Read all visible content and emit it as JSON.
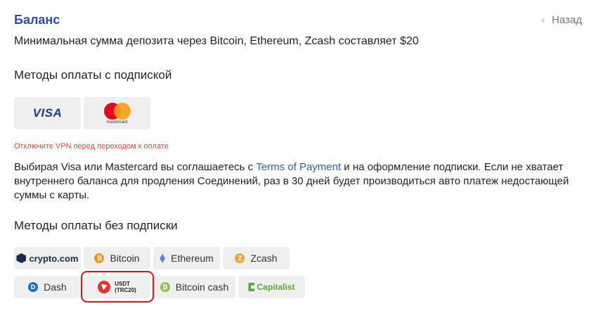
{
  "header": {
    "title": "Баланс",
    "back_label": "Назад"
  },
  "subtitle": "Минимальная сумма депозита через Bitcoin, Ethereum, Zcash составляет $20",
  "subscription": {
    "heading": "Методы оплаты с подпиской",
    "visa_label": "VISA",
    "mastercard_label": "mastercard",
    "warning": "Отключите VPN перед переходом к оплате",
    "para_before": "Выбирая Visa или Mastercard вы соглашаетесь с ",
    "terms_link": "Terms of Payment",
    "para_after": " и на оформление подписки. Если не хватает внутреннего баланса для продления Соединений, раз в 30 дней будет производиться авто платеж недостающей суммы с карты."
  },
  "no_subscription": {
    "heading": "Методы оплаты без подписки",
    "methods": {
      "crypto_com": "crypto.com",
      "bitcoin": "Bitcoin",
      "ethereum": "Ethereum",
      "zcash": "Zcash",
      "dash": "Dash",
      "usdt_line1": "USDT",
      "usdt_line2": "(TRC20)",
      "bitcoin_cash": "Bitcoin cash",
      "capitalist": "Capitalist"
    }
  },
  "colors": {
    "title": "#2b4fa6",
    "warning": "#e0473a",
    "link": "#2b5fb0",
    "highlight": "#e1141b",
    "bitcoin": "#f7931a",
    "zcash": "#e8a93a",
    "dash": "#1c75bc",
    "bitcoin_cash": "#8dc351"
  },
  "icons": [
    "chevron-left-icon",
    "visa-logo",
    "mastercard-logo",
    "crypto-com-logo",
    "bitcoin-icon",
    "ethereum-icon",
    "zcash-icon",
    "dash-icon",
    "usdt-trc20-logo",
    "bitcoin-cash-icon",
    "capitalist-logo"
  ]
}
